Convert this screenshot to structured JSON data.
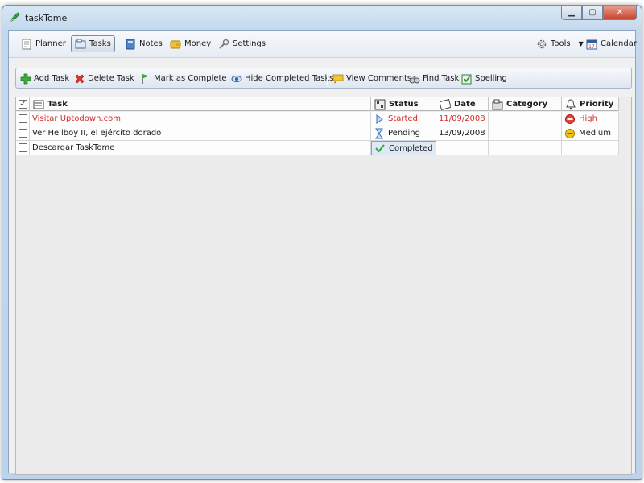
{
  "window": {
    "title": "taskTome"
  },
  "nav": {
    "planner": "Planner",
    "tasks": "Tasks",
    "notes": "Notes",
    "money": "Money",
    "settings": "Settings",
    "tools": "Tools",
    "calendar": "Calendar"
  },
  "toolbar": {
    "add_task": "Add Task",
    "delete_task": "Delete Task",
    "mark_complete": "Mark as Complete",
    "hide_completed": "Hide Completed Tasks",
    "view_comments": "View Comments",
    "find_task": "Find Task",
    "spelling": "Spelling"
  },
  "columns": {
    "task": "Task",
    "status": "Status",
    "date": "Date",
    "category": "Category",
    "priority": "Priority"
  },
  "rows": [
    {
      "task": "Visitar Uptodown.com",
      "status": "Started",
      "date": "11/09/2008",
      "category": "",
      "priority": "High",
      "checked": false,
      "color": "#d42a2a"
    },
    {
      "task": "Ver Hellboy II, el ejército dorado",
      "status": "Pending",
      "date": "13/09/2008",
      "category": "",
      "priority": "Medium",
      "checked": false,
      "color": "#1a1a1a"
    },
    {
      "task": "Descargar TaskTome",
      "status": "Completed",
      "date": "",
      "category": "",
      "priority": "",
      "checked": false,
      "color": "#1a1a1a"
    }
  ],
  "colors": {
    "high_priority": "#e8413b",
    "medium_priority": "#f0c419",
    "accent": "#d42a2a"
  }
}
